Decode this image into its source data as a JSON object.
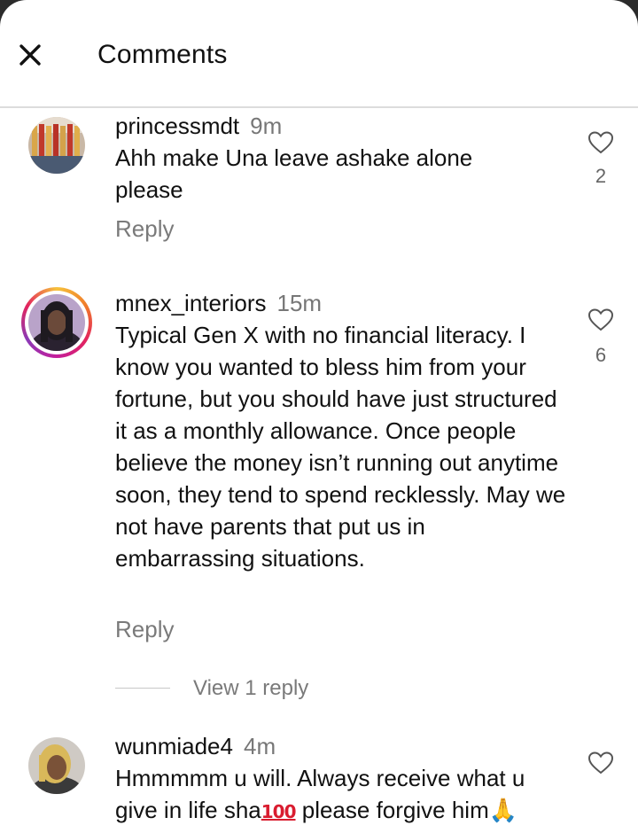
{
  "header": {
    "title": "Comments"
  },
  "comments": [
    {
      "username": "princessmdt",
      "time": "9m",
      "text": "Ahh make Una leave ashake alone please",
      "reply_label": "Reply",
      "likes": "2"
    },
    {
      "username": "mnex_interiors",
      "time": "15m",
      "text": "Typical Gen X with no financial literacy. I know you wanted to bless him from your fortune, but you should have just structured it as a monthly allowance. Once people believe the money isn’t running out anytime soon, they tend to spend recklessly. May we not have parents that put us in embarrassing situations.",
      "reply_label": "Reply",
      "likes": "6",
      "view_replies": "View 1 reply"
    },
    {
      "username": "wunmiade4",
      "time": "4m",
      "text_part1": "Hmmmmm u will. Always receive what u give in life sha",
      "emoji_hundred": "100",
      "text_part2": " please forgive him",
      "emoji_pray": "🙏"
    }
  ],
  "icons": {
    "close": "close-icon",
    "like": "heart-outline-icon"
  },
  "colors": {
    "secondary_text": "#777777",
    "ring_gradient": [
      "#f6c23b",
      "#e3245d",
      "#c41d9b"
    ]
  }
}
